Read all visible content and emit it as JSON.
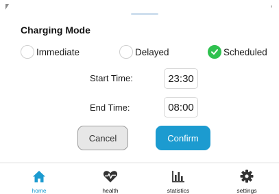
{
  "sheet": {
    "title": "Charging Mode"
  },
  "modes": [
    {
      "label": "Immediate",
      "checked": false
    },
    {
      "label": "Delayed",
      "checked": false
    },
    {
      "label": "Scheduled",
      "checked": true
    }
  ],
  "schedule": {
    "start_label": "Start Time:",
    "start_value": "23:30",
    "end_label": "End Time:",
    "end_value": "08:00"
  },
  "actions": {
    "cancel_label": "Cancel",
    "confirm_label": "Confirm"
  },
  "tabs": [
    {
      "label": "home",
      "icon": "home-icon",
      "active": true
    },
    {
      "label": "health",
      "icon": "heartbeat-icon",
      "active": false
    },
    {
      "label": "statistics",
      "icon": "bar-chart-icon",
      "active": false
    },
    {
      "label": "settings",
      "icon": "gear-icon",
      "active": false
    }
  ],
  "colors": {
    "accent": "#1c9bd0",
    "checked": "#2fc14f",
    "icon_dark": "#333333"
  }
}
